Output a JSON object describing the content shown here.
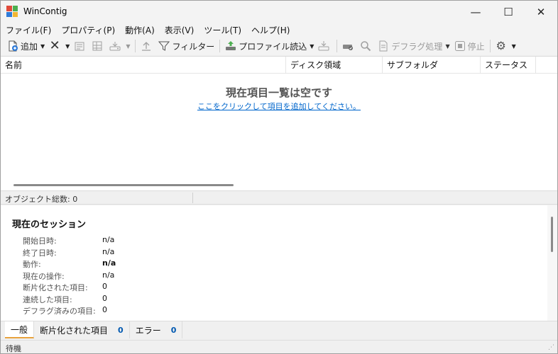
{
  "window": {
    "title": "WinContig",
    "minimize_glyph": "—",
    "maximize_glyph": "☐",
    "close_glyph": "✕"
  },
  "colors": {
    "accent_tab": "#e8a23c",
    "link": "#0066cc",
    "count": "#0058b0",
    "icon_red": "#e04a3a",
    "icon_green": "#4caf50",
    "icon_blue": "#2f7bd8",
    "icon_yellow": "#f2b632"
  },
  "menu": [
    "ファイル(F)",
    "プロパティ(P)",
    "動作(A)",
    "表示(V)",
    "ツール(T)",
    "ヘルプ(H)"
  ],
  "toolbar": {
    "add": {
      "icon": "add-file-icon",
      "label": "追加"
    },
    "remove": {
      "icon": "remove-x-icon",
      "label": ""
    },
    "filter": {
      "icon": "filter-icon",
      "label": "フィルター"
    },
    "load_profile": {
      "icon": "profile-load-icon",
      "label": "プロファイル読込"
    },
    "defrag": {
      "icon": "defrag-icon",
      "label": "デフラグ処理"
    },
    "stop": {
      "icon": "stop-icon",
      "label": "停止"
    },
    "settings": {
      "icon": "gear-icon",
      "label": ""
    }
  },
  "list": {
    "columns": [
      "名前",
      "ディスク領域",
      "サブフォルダ",
      "ステータス"
    ],
    "empty_title": "現在項目一覧は空です",
    "empty_link": "ここをクリックして項目を追加してください。"
  },
  "status_top": "オブジェクト総数: 0",
  "session": {
    "title": "現在のセッション",
    "rows": [
      {
        "label": "開始日時:",
        "value": "n/a",
        "bold": false
      },
      {
        "label": "終了日時:",
        "value": "n/a",
        "bold": false
      },
      {
        "label": "動作:",
        "value": "n/a",
        "bold": true
      },
      {
        "label": "現在の操作:",
        "value": "n/a",
        "bold": false
      },
      {
        "label": "断片化された項目:",
        "value": "0",
        "bold": false
      },
      {
        "label": "連続した項目:",
        "value": "0",
        "bold": false
      },
      {
        "label": "デフラグ済みの項目:",
        "value": "0",
        "bold": false
      }
    ]
  },
  "tabs": [
    {
      "label": "一般",
      "count": ""
    },
    {
      "label": "断片化された項目",
      "count": "0"
    },
    {
      "label": "エラー",
      "count": "0"
    }
  ],
  "status_bottom": "待機"
}
